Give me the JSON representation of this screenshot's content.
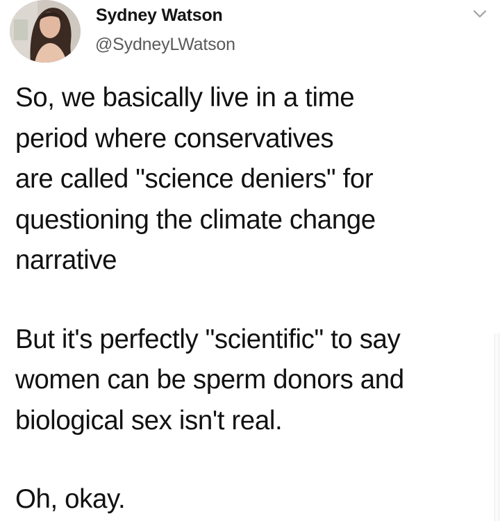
{
  "tweet": {
    "author": {
      "display_name": "Sydney Watson",
      "handle": "@SydneyLWatson"
    },
    "menu_icon": "chevron-down-icon",
    "avatar_icon": "profile-photo",
    "body": {
      "paragraph1": [
        "So, we basically live in a time",
        "period where conservatives",
        "are called \"science deniers\" for",
        "questioning the climate change",
        "narrative"
      ],
      "paragraph2": [
        "But it's perfectly \"scientific\" to say",
        "women can be sperm donors and",
        "biological sex isn't real."
      ],
      "paragraph3": [
        "Oh, okay."
      ]
    }
  }
}
